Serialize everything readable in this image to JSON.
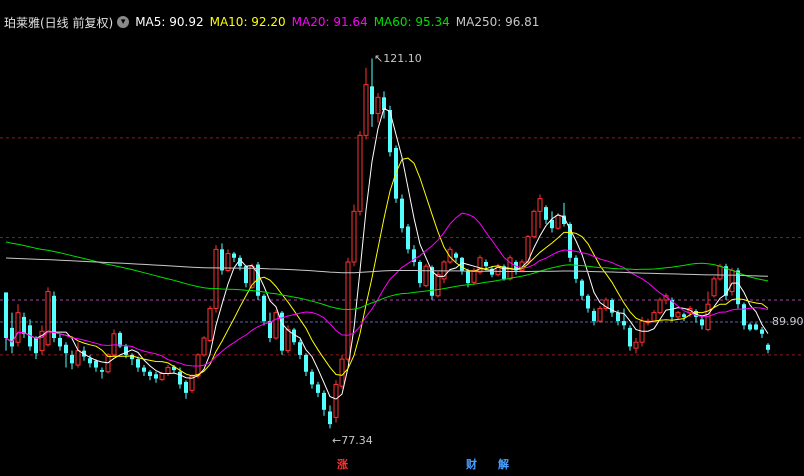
{
  "header": {
    "title": "珀莱雅(日线 前复权)",
    "menu_icon": "chevron-down-icon",
    "ma": [
      {
        "label": "MA5: 90.92",
        "color": "#ffffff"
      },
      {
        "label": "MA10: 92.20",
        "color": "#ffff00"
      },
      {
        "label": "MA20: 91.64",
        "color": "#ff00ff"
      },
      {
        "label": "MA60: 95.34",
        "color": "#00e000"
      },
      {
        "label": "MA250: 96.81",
        "color": "#c8c8c8"
      }
    ]
  },
  "annotations": {
    "high": "121.10",
    "low": "77.34",
    "current": "89.90"
  },
  "events": [
    {
      "label": "涨",
      "color": "#ff3030"
    },
    {
      "label": "财",
      "color": "#4aa0ff"
    },
    {
      "label": "解",
      "color": "#4aa0ff"
    }
  ],
  "colors": {
    "up": "#ff3232",
    "down": "#54ffff",
    "background": "#000000",
    "grid_red": "#8b1a1a",
    "grid_purple": "#aa44aa",
    "grid_blue": "#6060a0"
  },
  "chart_data": {
    "type": "candlestick",
    "ylim": [
      74.5,
      124
    ],
    "reference_lines": [
      111.7,
      99.9,
      92.5,
      89.9,
      86.0
    ],
    "high_point": 121.1,
    "low_point": 77.34,
    "current_price": 89.9,
    "candles": [
      [
        93.4,
        88.0,
        86.5,
        88.0
      ],
      [
        89.2,
        87.0,
        86.2,
        91.0
      ],
      [
        87.5,
        91.0,
        87.0,
        92.0
      ],
      [
        90.5,
        88.5,
        88.0,
        91.0
      ],
      [
        89.5,
        87.0,
        86.5,
        90.2
      ],
      [
        88.0,
        86.2,
        85.5,
        88.2
      ],
      [
        86.5,
        88.8,
        86.0,
        89.5
      ],
      [
        87.2,
        93.5,
        87.0,
        94.0
      ],
      [
        93.0,
        88.0,
        87.5,
        93.5
      ],
      [
        88.0,
        87.0,
        86.5,
        88.5
      ],
      [
        87.2,
        86.2,
        84.5,
        87.5
      ],
      [
        86.0,
        85.0,
        84.3,
        86.5
      ],
      [
        84.8,
        86.5,
        84.5,
        87.5
      ],
      [
        86.5,
        85.8,
        85.3,
        87.0
      ],
      [
        85.6,
        85.0,
        84.5,
        86.0
      ],
      [
        85.3,
        84.5,
        84.0,
        85.5
      ],
      [
        84.2,
        84.0,
        83.2,
        84.5
      ],
      [
        84.0,
        86.0,
        83.8,
        86.2
      ],
      [
        86.0,
        88.5,
        85.8,
        89.0
      ],
      [
        88.6,
        87.0,
        86.8,
        88.8
      ],
      [
        87.0,
        86.0,
        85.6,
        87.3
      ],
      [
        86.0,
        85.5,
        84.8,
        86.2
      ],
      [
        85.5,
        84.5,
        84.0,
        85.8
      ],
      [
        84.5,
        84.0,
        83.5,
        84.8
      ],
      [
        84.0,
        83.5,
        83.0,
        84.2
      ],
      [
        83.7,
        83.2,
        82.7,
        84.0
      ],
      [
        83.1,
        83.8,
        82.9,
        84.0
      ],
      [
        83.8,
        84.5,
        83.5,
        84.8
      ],
      [
        84.6,
        84.2,
        83.8,
        84.8
      ],
      [
        84.0,
        82.5,
        82.0,
        84.5
      ],
      [
        82.8,
        81.5,
        80.8,
        83.0
      ],
      [
        81.8,
        83.5,
        81.5,
        83.7
      ],
      [
        83.5,
        86.0,
        83.2,
        86.2
      ],
      [
        86.0,
        88.0,
        85.8,
        88.2
      ],
      [
        87.7,
        91.5,
        87.5,
        91.8
      ],
      [
        91.5,
        98.5,
        91.0,
        99.0
      ],
      [
        98.5,
        96.0,
        95.5,
        99.2
      ],
      [
        96.0,
        98.0,
        95.8,
        98.5
      ],
      [
        98.0,
        97.5,
        97.0,
        98.2
      ],
      [
        97.5,
        96.5,
        96.0,
        97.8
      ],
      [
        96.5,
        94.5,
        94.0,
        96.6
      ],
      [
        94.0,
        96.5,
        93.8,
        96.8
      ],
      [
        96.7,
        93.0,
        92.5,
        97.0
      ],
      [
        93.0,
        90.0,
        89.5,
        93.2
      ],
      [
        90.0,
        88.0,
        87.5,
        91.0
      ],
      [
        88.0,
        91.0,
        87.8,
        91.3
      ],
      [
        91.0,
        86.5,
        86.0,
        91.2
      ],
      [
        86.5,
        89.0,
        86.2,
        89.5
      ],
      [
        89.0,
        87.5,
        87.2,
        89.2
      ],
      [
        87.5,
        86.0,
        85.5,
        87.8
      ],
      [
        86.0,
        84.0,
        83.5,
        86.2
      ],
      [
        84.0,
        82.5,
        82.0,
        84.3
      ],
      [
        82.5,
        81.5,
        81.0,
        82.8
      ],
      [
        81.5,
        79.5,
        78.8,
        81.8
      ],
      [
        79.3,
        77.8,
        77.3,
        80.0
      ],
      [
        78.6,
        82.5,
        78.0,
        83.0
      ],
      [
        82.3,
        85.5,
        82.0,
        86.0
      ],
      [
        85.5,
        97.0,
        85.2,
        97.5
      ],
      [
        97.0,
        103.0,
        96.5,
        103.8
      ],
      [
        103.0,
        112.0,
        102.5,
        112.5
      ],
      [
        112.0,
        118.0,
        111.5,
        120.0
      ],
      [
        117.8,
        114.5,
        113.0,
        121.1
      ],
      [
        114.6,
        116.5,
        113.5,
        117.0
      ],
      [
        116.5,
        115.0,
        114.0,
        117.2
      ],
      [
        115.0,
        110.0,
        109.5,
        115.5
      ],
      [
        110.5,
        104.5,
        104.0,
        110.8
      ],
      [
        104.5,
        101.0,
        100.5,
        105.0
      ],
      [
        101.2,
        98.5,
        98.0,
        101.5
      ],
      [
        98.5,
        97.0,
        96.5,
        99.0
      ],
      [
        97.0,
        94.5,
        94.0,
        97.2
      ],
      [
        94.2,
        96.5,
        94.0,
        96.8
      ],
      [
        96.4,
        93.0,
        92.5,
        96.6
      ],
      [
        93.0,
        95.5,
        92.8,
        95.8
      ],
      [
        95.0,
        97.0,
        94.5,
        97.2
      ],
      [
        97.0,
        98.5,
        96.8,
        98.8
      ],
      [
        98.0,
        97.5,
        97.0,
        98.2
      ],
      [
        97.5,
        96.0,
        95.5,
        97.6
      ],
      [
        96.0,
        94.5,
        94.0,
        96.2
      ],
      [
        94.6,
        96.0,
        94.3,
        96.3
      ],
      [
        95.8,
        97.5,
        95.5,
        97.8
      ],
      [
        97.0,
        96.5,
        96.0,
        97.3
      ],
      [
        96.2,
        95.5,
        95.2,
        96.5
      ],
      [
        95.5,
        96.5,
        95.3,
        96.8
      ],
      [
        96.5,
        95.0,
        94.8,
        96.7
      ],
      [
        95.0,
        97.5,
        94.8,
        97.8
      ],
      [
        97.0,
        96.0,
        95.5,
        97.2
      ],
      [
        96.0,
        97.0,
        95.8,
        97.3
      ],
      [
        97.0,
        100.0,
        96.8,
        100.2
      ],
      [
        100.0,
        103.0,
        99.8,
        103.2
      ],
      [
        103.0,
        104.5,
        101.0,
        105.0
      ],
      [
        103.5,
        102.0,
        101.5,
        103.7
      ],
      [
        102.0,
        101.0,
        100.5,
        103.0
      ],
      [
        101.0,
        102.5,
        100.8,
        102.8
      ],
      [
        102.5,
        101.5,
        101.2,
        104.0
      ],
      [
        101.5,
        97.5,
        97.0,
        101.7
      ],
      [
        97.5,
        95.0,
        94.5,
        97.8
      ],
      [
        94.8,
        93.0,
        92.5,
        95.0
      ],
      [
        93.0,
        91.5,
        91.0,
        93.2
      ],
      [
        91.2,
        90.0,
        89.5,
        91.5
      ],
      [
        90.0,
        91.5,
        89.8,
        91.8
      ],
      [
        91.5,
        92.5,
        91.2,
        92.8
      ],
      [
        92.5,
        91.0,
        90.5,
        92.7
      ],
      [
        91.0,
        90.0,
        89.5,
        91.3
      ],
      [
        90.0,
        89.5,
        89.0,
        91.5
      ],
      [
        89.2,
        87.0,
        86.5,
        89.5
      ],
      [
        86.8,
        87.5,
        86.2,
        88.0
      ],
      [
        87.5,
        90.0,
        87.0,
        90.5
      ],
      [
        89.8,
        90.0,
        89.5,
        90.3
      ],
      [
        90.0,
        91.0,
        89.8,
        91.3
      ],
      [
        91.0,
        92.5,
        90.8,
        92.8
      ],
      [
        92.5,
        93.0,
        92.0,
        93.3
      ],
      [
        92.5,
        90.5,
        90.0,
        92.8
      ],
      [
        90.5,
        91.0,
        90.2,
        91.2
      ],
      [
        90.8,
        90.5,
        90.0,
        91.0
      ],
      [
        91.0,
        91.5,
        90.5,
        91.8
      ],
      [
        91.2,
        90.5,
        89.8,
        91.4
      ],
      [
        90.2,
        89.5,
        89.0,
        90.5
      ],
      [
        89.0,
        92.0,
        88.8,
        93.5
      ],
      [
        93.0,
        95.0,
        92.8,
        95.3
      ],
      [
        95.0,
        96.5,
        94.8,
        96.8
      ],
      [
        96.5,
        93.0,
        92.5,
        96.8
      ],
      [
        93.5,
        96.0,
        93.0,
        96.3
      ],
      [
        96.0,
        92.0,
        91.5,
        96.3
      ],
      [
        92.0,
        89.5,
        89.0,
        92.2
      ],
      [
        89.6,
        89.0,
        88.8,
        89.8
      ],
      [
        89.6,
        89.0,
        88.9,
        89.8
      ],
      [
        89.0,
        88.5,
        88.0,
        89.3
      ],
      [
        87.2,
        86.6,
        86.2,
        87.4
      ]
    ],
    "ma": [
      {
        "name": "MA5",
        "color": "#ffffff",
        "period": 5
      },
      {
        "name": "MA10",
        "color": "#ffff00",
        "period": 10
      },
      {
        "name": "MA20",
        "color": "#ff00ff",
        "period": 20
      },
      {
        "name": "MA60",
        "color": "#00e000",
        "period": 60
      },
      {
        "name": "MA250",
        "color": "#c8c8c8",
        "period": 250
      }
    ]
  }
}
